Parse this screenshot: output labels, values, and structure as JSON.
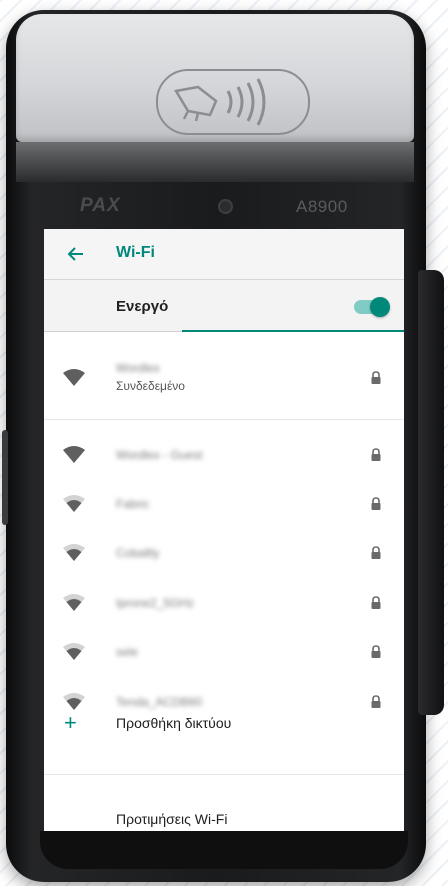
{
  "device": {
    "brand": "PAX",
    "model": "A8900"
  },
  "appbar": {
    "back_icon": "arrow-left-icon",
    "title": "Wi-Fi"
  },
  "master_switch": {
    "label": "Ενεργό",
    "on": true
  },
  "networks": [
    {
      "name": "Wordlex",
      "status": "Συνδεδεμένο",
      "signal": "full",
      "locked": true
    },
    {
      "name": "Wordlex - Guest",
      "status": "",
      "signal": "full",
      "locked": true
    },
    {
      "name": "Fabric",
      "status": "",
      "signal": "medium",
      "locked": true
    },
    {
      "name": "Cobaltly",
      "status": "",
      "signal": "medium",
      "locked": true
    },
    {
      "name": "Iprone2_5GHz",
      "status": "",
      "signal": "medium",
      "locked": true
    },
    {
      "name": "sele",
      "status": "",
      "signal": "medium",
      "locked": true
    },
    {
      "name": "Tenda_ACDB60",
      "status": "",
      "signal": "medium",
      "locked": true
    }
  ],
  "actions": {
    "add_network_label": "Προσθήκη δικτύου",
    "preferences_label": "Προτιμήσεις Wi-Fi"
  },
  "colors": {
    "accent": "#00897b",
    "accent_light": "#80cbc4"
  }
}
